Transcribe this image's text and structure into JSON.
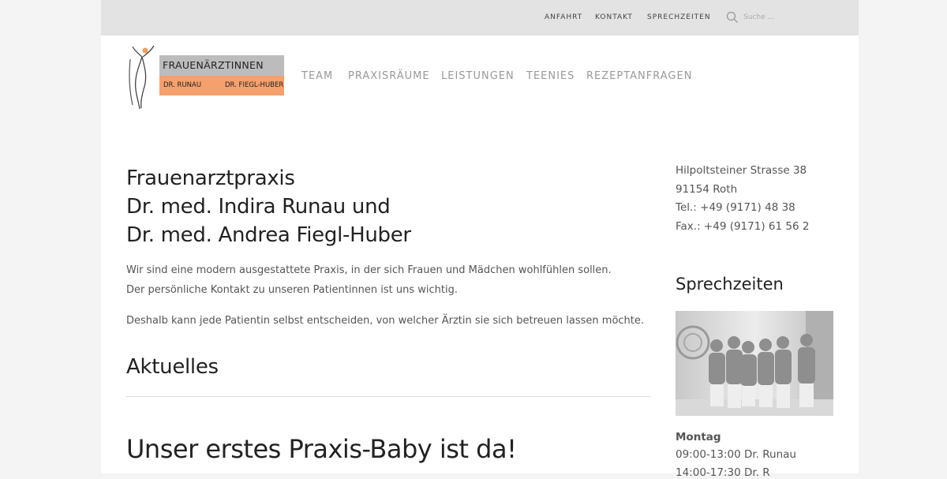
{
  "topbar": {
    "links": [
      "ANFAHRT",
      "KONTAKT",
      "SPRECHZEITEN"
    ],
    "search_placeholder": "Suche ...",
    "search_icon": "search-icon"
  },
  "logo": {
    "title": "FRAUENÄRZTINNEN",
    "doctor1": "DR. RUNAU",
    "doctor2": "DR. FIEGL-HUBER",
    "color_top": "#bcbcbc",
    "color_bottom": "#f5a06d"
  },
  "mainnav": [
    "TEAM",
    "PRAXISRÄUME",
    "LEISTUNGEN",
    "TEENIES",
    "REZEPTANFRAGEN"
  ],
  "main": {
    "title_lines": [
      "Frauenarztpraxis",
      "Dr. med. Indira Runau und",
      "Dr. med. Andrea Fiegl-Huber"
    ],
    "intro": "Wir sind eine modern ausgestattete Praxis, in der sich Frauen und Mädchen wohlfühlen sollen. Der persönliche Kontakt zu unseren Patientinnen ist uns wichtig.",
    "intro2": "Deshalb kann jede Patientin selbst entscheiden, von welcher Ärztin sie sich betreuen lassen möchte.",
    "news_heading": "Aktuelles",
    "post_title": "Unser erstes Praxis-Baby ist da!"
  },
  "sidebar": {
    "address": [
      "Hilpoltsteiner Strasse 38",
      "91154 Roth",
      "Tel.: +49 (9171) 48 38",
      "Fax.: +49 (9171) 61 56 2"
    ],
    "hours_heading": "Sprechzeiten",
    "day": "Montag",
    "hours": [
      "09:00-13:00 Dr. Runau",
      "14:00-17:30 Dr. R"
    ]
  }
}
